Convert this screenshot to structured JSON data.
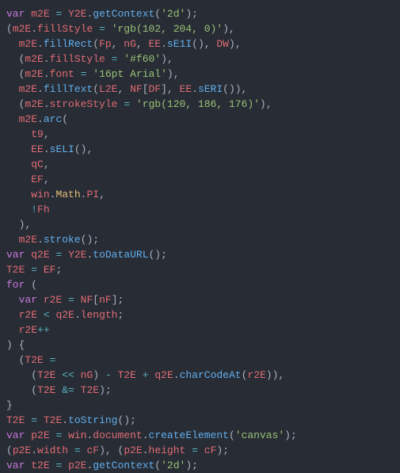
{
  "code": {
    "lines": [
      [
        {
          "t": "kw",
          "v": "var"
        },
        {
          "t": "pln",
          "v": " "
        },
        {
          "t": "var",
          "v": "m2E"
        },
        {
          "t": "pln",
          "v": " "
        },
        {
          "t": "op",
          "v": "="
        },
        {
          "t": "pln",
          "v": " "
        },
        {
          "t": "var",
          "v": "Y2E"
        },
        {
          "t": "pun",
          "v": "."
        },
        {
          "t": "func",
          "v": "getContext"
        },
        {
          "t": "pun",
          "v": "("
        },
        {
          "t": "str",
          "v": "'2d'"
        },
        {
          "t": "pun",
          "v": ");"
        }
      ],
      [
        {
          "t": "pun",
          "v": "("
        },
        {
          "t": "var",
          "v": "m2E"
        },
        {
          "t": "pun",
          "v": "."
        },
        {
          "t": "prop",
          "v": "fillStyle"
        },
        {
          "t": "pln",
          "v": " "
        },
        {
          "t": "op",
          "v": "="
        },
        {
          "t": "pln",
          "v": " "
        },
        {
          "t": "str",
          "v": "'rgb(102, 204, 0)'"
        },
        {
          "t": "pun",
          "v": "),"
        }
      ],
      [
        {
          "t": "pln",
          "v": "  "
        },
        {
          "t": "var",
          "v": "m2E"
        },
        {
          "t": "pun",
          "v": "."
        },
        {
          "t": "func",
          "v": "fillRect"
        },
        {
          "t": "pun",
          "v": "("
        },
        {
          "t": "var",
          "v": "Fp"
        },
        {
          "t": "pun",
          "v": ", "
        },
        {
          "t": "var",
          "v": "nG"
        },
        {
          "t": "pun",
          "v": ", "
        },
        {
          "t": "var",
          "v": "EE"
        },
        {
          "t": "pun",
          "v": "."
        },
        {
          "t": "func",
          "v": "sE1I"
        },
        {
          "t": "pun",
          "v": "(), "
        },
        {
          "t": "var",
          "v": "DW"
        },
        {
          "t": "pun",
          "v": "),"
        }
      ],
      [
        {
          "t": "pln",
          "v": "  ("
        },
        {
          "t": "var",
          "v": "m2E"
        },
        {
          "t": "pun",
          "v": "."
        },
        {
          "t": "prop",
          "v": "fillStyle"
        },
        {
          "t": "pln",
          "v": " "
        },
        {
          "t": "op",
          "v": "="
        },
        {
          "t": "pln",
          "v": " "
        },
        {
          "t": "str",
          "v": "'#f60'"
        },
        {
          "t": "pun",
          "v": "),"
        }
      ],
      [
        {
          "t": "pln",
          "v": "  ("
        },
        {
          "t": "var",
          "v": "m2E"
        },
        {
          "t": "pun",
          "v": "."
        },
        {
          "t": "prop",
          "v": "font"
        },
        {
          "t": "pln",
          "v": " "
        },
        {
          "t": "op",
          "v": "="
        },
        {
          "t": "pln",
          "v": " "
        },
        {
          "t": "str",
          "v": "'16pt Arial'"
        },
        {
          "t": "pun",
          "v": "),"
        }
      ],
      [
        {
          "t": "pln",
          "v": "  "
        },
        {
          "t": "var",
          "v": "m2E"
        },
        {
          "t": "pun",
          "v": "."
        },
        {
          "t": "func",
          "v": "fillText"
        },
        {
          "t": "pun",
          "v": "("
        },
        {
          "t": "var",
          "v": "L2E"
        },
        {
          "t": "pun",
          "v": ", "
        },
        {
          "t": "var",
          "v": "NF"
        },
        {
          "t": "pun",
          "v": "["
        },
        {
          "t": "var",
          "v": "DF"
        },
        {
          "t": "pun",
          "v": "], "
        },
        {
          "t": "var",
          "v": "EE"
        },
        {
          "t": "pun",
          "v": "."
        },
        {
          "t": "func",
          "v": "sERI"
        },
        {
          "t": "pun",
          "v": "()),"
        }
      ],
      [
        {
          "t": "pln",
          "v": "  ("
        },
        {
          "t": "var",
          "v": "m2E"
        },
        {
          "t": "pun",
          "v": "."
        },
        {
          "t": "prop",
          "v": "strokeStyle"
        },
        {
          "t": "pln",
          "v": " "
        },
        {
          "t": "op",
          "v": "="
        },
        {
          "t": "pln",
          "v": " "
        },
        {
          "t": "str",
          "v": "'rgb(120, 186, 176)'"
        },
        {
          "t": "pun",
          "v": "),"
        }
      ],
      [
        {
          "t": "pln",
          "v": "  "
        },
        {
          "t": "var",
          "v": "m2E"
        },
        {
          "t": "pun",
          "v": "."
        },
        {
          "t": "func",
          "v": "arc"
        },
        {
          "t": "pun",
          "v": "("
        }
      ],
      [
        {
          "t": "pln",
          "v": "    "
        },
        {
          "t": "var",
          "v": "t9"
        },
        {
          "t": "pun",
          "v": ","
        }
      ],
      [
        {
          "t": "pln",
          "v": "    "
        },
        {
          "t": "var",
          "v": "EE"
        },
        {
          "t": "pun",
          "v": "."
        },
        {
          "t": "func",
          "v": "sELI"
        },
        {
          "t": "pun",
          "v": "(),"
        }
      ],
      [
        {
          "t": "pln",
          "v": "    "
        },
        {
          "t": "var",
          "v": "qC"
        },
        {
          "t": "pun",
          "v": ","
        }
      ],
      [
        {
          "t": "pln",
          "v": "    "
        },
        {
          "t": "var",
          "v": "EF"
        },
        {
          "t": "pun",
          "v": ","
        }
      ],
      [
        {
          "t": "pln",
          "v": "    "
        },
        {
          "t": "var",
          "v": "win"
        },
        {
          "t": "pun",
          "v": "."
        },
        {
          "t": "obj",
          "v": "Math"
        },
        {
          "t": "pun",
          "v": "."
        },
        {
          "t": "prop",
          "v": "PI"
        },
        {
          "t": "pun",
          "v": ","
        }
      ],
      [
        {
          "t": "pln",
          "v": "    "
        },
        {
          "t": "op",
          "v": "!"
        },
        {
          "t": "var",
          "v": "Fh"
        }
      ],
      [
        {
          "t": "pln",
          "v": "  "
        },
        {
          "t": "pun",
          "v": "),"
        }
      ],
      [
        {
          "t": "pln",
          "v": "  "
        },
        {
          "t": "var",
          "v": "m2E"
        },
        {
          "t": "pun",
          "v": "."
        },
        {
          "t": "func",
          "v": "stroke"
        },
        {
          "t": "pun",
          "v": "();"
        }
      ],
      [
        {
          "t": "kw",
          "v": "var"
        },
        {
          "t": "pln",
          "v": " "
        },
        {
          "t": "var",
          "v": "q2E"
        },
        {
          "t": "pln",
          "v": " "
        },
        {
          "t": "op",
          "v": "="
        },
        {
          "t": "pln",
          "v": " "
        },
        {
          "t": "var",
          "v": "Y2E"
        },
        {
          "t": "pun",
          "v": "."
        },
        {
          "t": "func",
          "v": "toDataURL"
        },
        {
          "t": "pun",
          "v": "();"
        }
      ],
      [
        {
          "t": "var",
          "v": "T2E"
        },
        {
          "t": "pln",
          "v": " "
        },
        {
          "t": "op",
          "v": "="
        },
        {
          "t": "pln",
          "v": " "
        },
        {
          "t": "var",
          "v": "EF"
        },
        {
          "t": "pun",
          "v": ";"
        }
      ],
      [
        {
          "t": "kw",
          "v": "for"
        },
        {
          "t": "pln",
          "v": " ("
        }
      ],
      [
        {
          "t": "pln",
          "v": "  "
        },
        {
          "t": "kw",
          "v": "var"
        },
        {
          "t": "pln",
          "v": " "
        },
        {
          "t": "var",
          "v": "r2E"
        },
        {
          "t": "pln",
          "v": " "
        },
        {
          "t": "op",
          "v": "="
        },
        {
          "t": "pln",
          "v": " "
        },
        {
          "t": "var",
          "v": "NF"
        },
        {
          "t": "pun",
          "v": "["
        },
        {
          "t": "var",
          "v": "nF"
        },
        {
          "t": "pun",
          "v": "];"
        }
      ],
      [
        {
          "t": "pln",
          "v": "  "
        },
        {
          "t": "var",
          "v": "r2E"
        },
        {
          "t": "pln",
          "v": " "
        },
        {
          "t": "op",
          "v": "<"
        },
        {
          "t": "pln",
          "v": " "
        },
        {
          "t": "var",
          "v": "q2E"
        },
        {
          "t": "pun",
          "v": "."
        },
        {
          "t": "prop",
          "v": "length"
        },
        {
          "t": "pun",
          "v": ";"
        }
      ],
      [
        {
          "t": "pln",
          "v": "  "
        },
        {
          "t": "var",
          "v": "r2E"
        },
        {
          "t": "op",
          "v": "++"
        }
      ],
      [
        {
          "t": "pun",
          "v": ") {"
        }
      ],
      [
        {
          "t": "pln",
          "v": "  ("
        },
        {
          "t": "var",
          "v": "T2E"
        },
        {
          "t": "pln",
          "v": " "
        },
        {
          "t": "op",
          "v": "="
        }
      ],
      [
        {
          "t": "pln",
          "v": "    ("
        },
        {
          "t": "var",
          "v": "T2E"
        },
        {
          "t": "pln",
          "v": " "
        },
        {
          "t": "op",
          "v": "<<"
        },
        {
          "t": "pln",
          "v": " "
        },
        {
          "t": "var",
          "v": "nG"
        },
        {
          "t": "pun",
          "v": ") "
        },
        {
          "t": "op",
          "v": "-"
        },
        {
          "t": "pln",
          "v": " "
        },
        {
          "t": "var",
          "v": "T2E"
        },
        {
          "t": "pln",
          "v": " "
        },
        {
          "t": "op",
          "v": "+"
        },
        {
          "t": "pln",
          "v": " "
        },
        {
          "t": "var",
          "v": "q2E"
        },
        {
          "t": "pun",
          "v": "."
        },
        {
          "t": "func",
          "v": "charCodeAt"
        },
        {
          "t": "pun",
          "v": "("
        },
        {
          "t": "var",
          "v": "r2E"
        },
        {
          "t": "pun",
          "v": ")),"
        }
      ],
      [
        {
          "t": "pln",
          "v": "    ("
        },
        {
          "t": "var",
          "v": "T2E"
        },
        {
          "t": "pln",
          "v": " "
        },
        {
          "t": "op",
          "v": "&="
        },
        {
          "t": "pln",
          "v": " "
        },
        {
          "t": "var",
          "v": "T2E"
        },
        {
          "t": "pun",
          "v": ");"
        }
      ],
      [
        {
          "t": "pun",
          "v": "}"
        }
      ],
      [
        {
          "t": "var",
          "v": "T2E"
        },
        {
          "t": "pln",
          "v": " "
        },
        {
          "t": "op",
          "v": "="
        },
        {
          "t": "pln",
          "v": " "
        },
        {
          "t": "var",
          "v": "T2E"
        },
        {
          "t": "pun",
          "v": "."
        },
        {
          "t": "func",
          "v": "toString"
        },
        {
          "t": "pun",
          "v": "();"
        }
      ],
      [
        {
          "t": "kw",
          "v": "var"
        },
        {
          "t": "pln",
          "v": " "
        },
        {
          "t": "var",
          "v": "p2E"
        },
        {
          "t": "pln",
          "v": " "
        },
        {
          "t": "op",
          "v": "="
        },
        {
          "t": "pln",
          "v": " "
        },
        {
          "t": "var",
          "v": "win"
        },
        {
          "t": "pun",
          "v": "."
        },
        {
          "t": "prop",
          "v": "document"
        },
        {
          "t": "pun",
          "v": "."
        },
        {
          "t": "func",
          "v": "createElement"
        },
        {
          "t": "pun",
          "v": "("
        },
        {
          "t": "str",
          "v": "'canvas'"
        },
        {
          "t": "pun",
          "v": ");"
        }
      ],
      [
        {
          "t": "pun",
          "v": "("
        },
        {
          "t": "var",
          "v": "p2E"
        },
        {
          "t": "pun",
          "v": "."
        },
        {
          "t": "prop",
          "v": "width"
        },
        {
          "t": "pln",
          "v": " "
        },
        {
          "t": "op",
          "v": "="
        },
        {
          "t": "pln",
          "v": " "
        },
        {
          "t": "var",
          "v": "cF"
        },
        {
          "t": "pun",
          "v": "), ("
        },
        {
          "t": "var",
          "v": "p2E"
        },
        {
          "t": "pun",
          "v": "."
        },
        {
          "t": "prop",
          "v": "height"
        },
        {
          "t": "pln",
          "v": " "
        },
        {
          "t": "op",
          "v": "="
        },
        {
          "t": "pln",
          "v": " "
        },
        {
          "t": "var",
          "v": "cF"
        },
        {
          "t": "pun",
          "v": ");"
        }
      ],
      [
        {
          "t": "kw",
          "v": "var"
        },
        {
          "t": "pln",
          "v": " "
        },
        {
          "t": "var",
          "v": "t2E"
        },
        {
          "t": "pln",
          "v": " "
        },
        {
          "t": "op",
          "v": "="
        },
        {
          "t": "pln",
          "v": " "
        },
        {
          "t": "var",
          "v": "p2E"
        },
        {
          "t": "pun",
          "v": "."
        },
        {
          "t": "func",
          "v": "getContext"
        },
        {
          "t": "pun",
          "v": "("
        },
        {
          "t": "str",
          "v": "'2d'"
        },
        {
          "t": "pun",
          "v": ");"
        }
      ]
    ]
  }
}
